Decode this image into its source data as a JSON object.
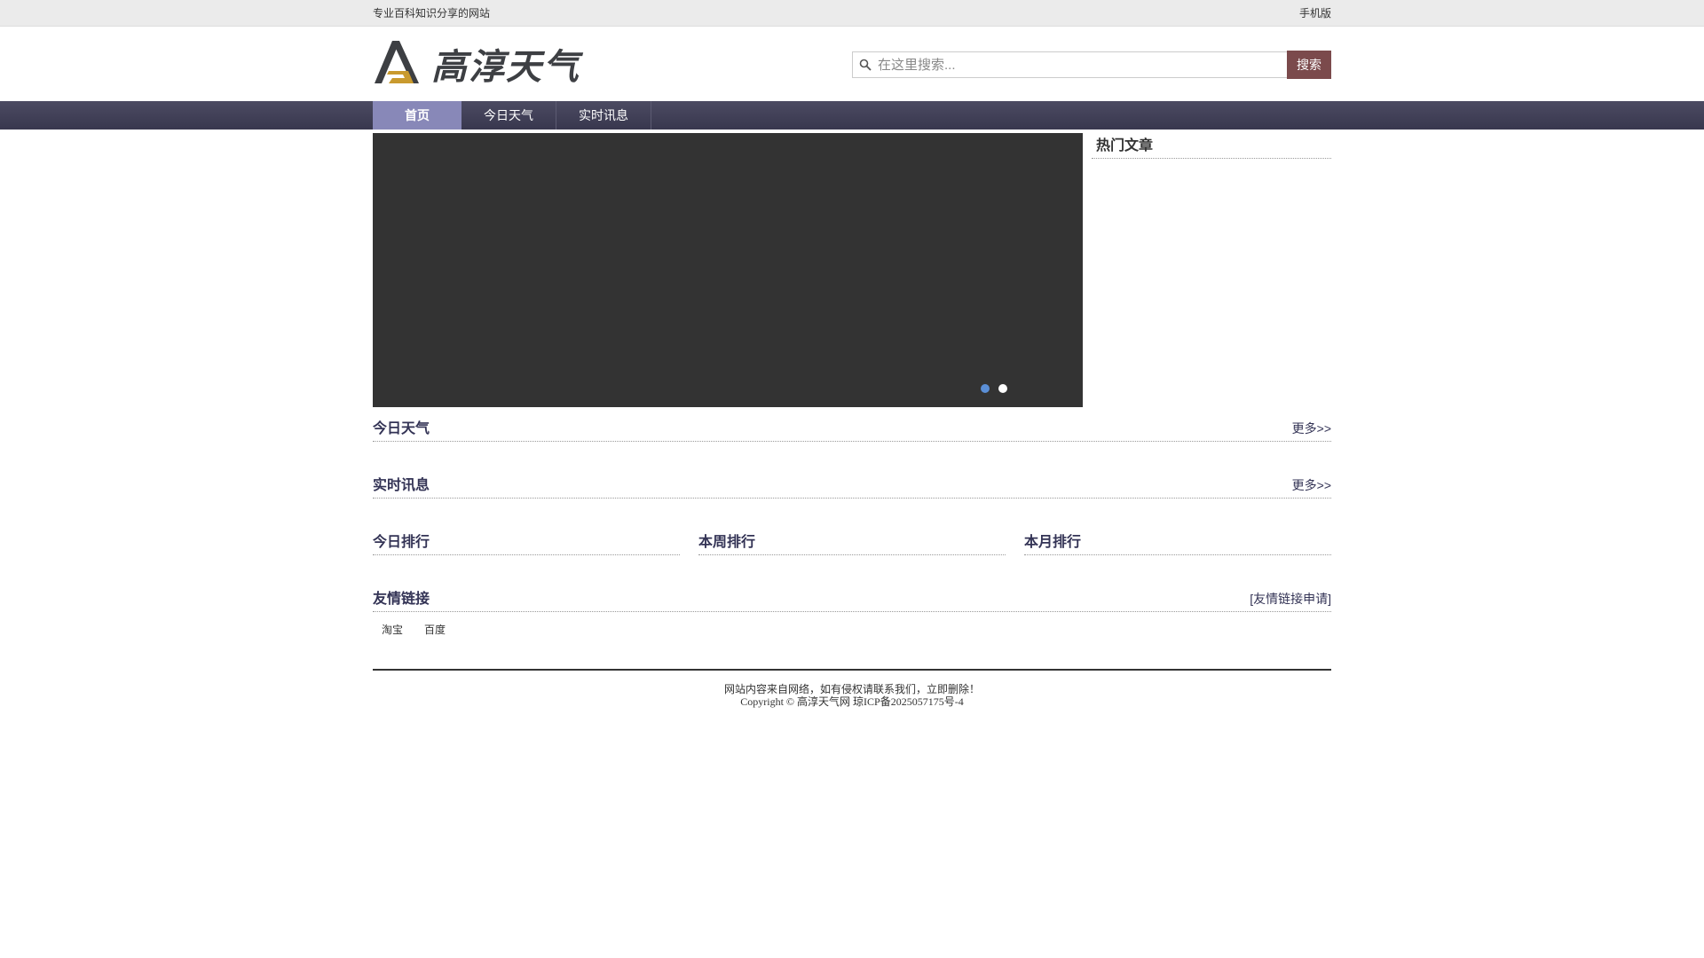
{
  "topbar": {
    "slogan": "专业百科知识分享的网站",
    "mobile": "手机版"
  },
  "header": {
    "site_name": "高淳天气"
  },
  "search": {
    "placeholder": "在这里搜索...",
    "button": "搜索"
  },
  "nav": {
    "items": [
      {
        "label": "首页"
      },
      {
        "label": "今日天气"
      },
      {
        "label": "实时讯息"
      }
    ]
  },
  "hot": {
    "title": "热门文章"
  },
  "sections": {
    "today_weather": {
      "title": "今日天气",
      "more": "更多>>"
    },
    "live_news": {
      "title": "实时讯息",
      "more": "更多>>"
    },
    "rank_day": {
      "title": "今日排行"
    },
    "rank_week": {
      "title": "本周排行"
    },
    "rank_month": {
      "title": "本月排行"
    },
    "links": {
      "title": "友情链接",
      "apply": "[友情链接申请]",
      "items": [
        "淘宝",
        "百度"
      ]
    }
  },
  "footer": {
    "notice": "网站内容来自网络，如有侵权请联系我们，立即删除！",
    "copyright": "Copyright © 高淳天气网 琼ICP备2025057175号-4"
  },
  "colors": {
    "nav_bg": "#42415a",
    "nav_active": "#8888b8",
    "search_button": "#7b4a4c",
    "slider_bg": "#333333",
    "dot_active": "#5b8fd6"
  },
  "icons": {
    "search": "search-icon",
    "logo": "logo-icon"
  }
}
